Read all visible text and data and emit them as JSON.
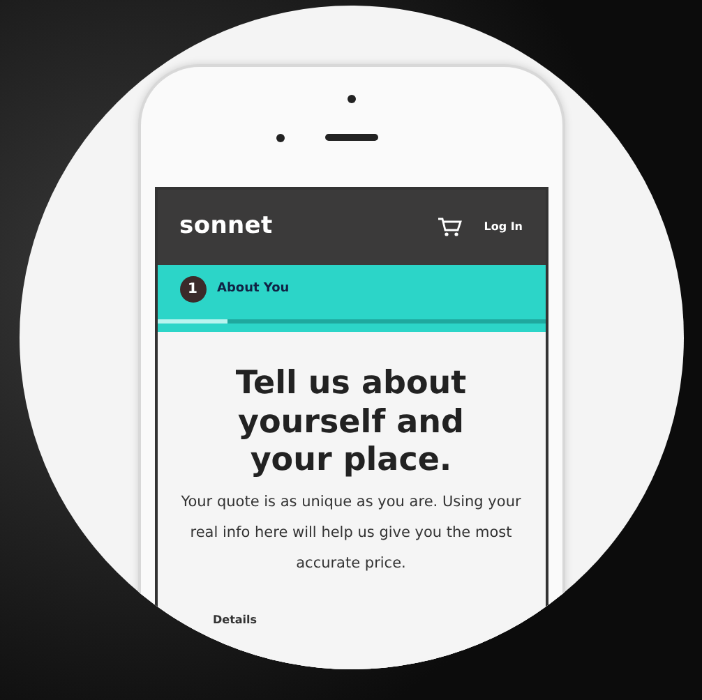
{
  "header": {
    "logo": "sonnet",
    "login": "Log In"
  },
  "steps": [
    {
      "number": "1",
      "label": "About You",
      "selected": true
    }
  ],
  "progress": {
    "level": 0.18
  },
  "heading": "Tell us about yourself and your place.",
  "intro": "Your quote is as unique as you are. Using your real info here will help us give you the most accurate price.",
  "section_label": "Details"
}
